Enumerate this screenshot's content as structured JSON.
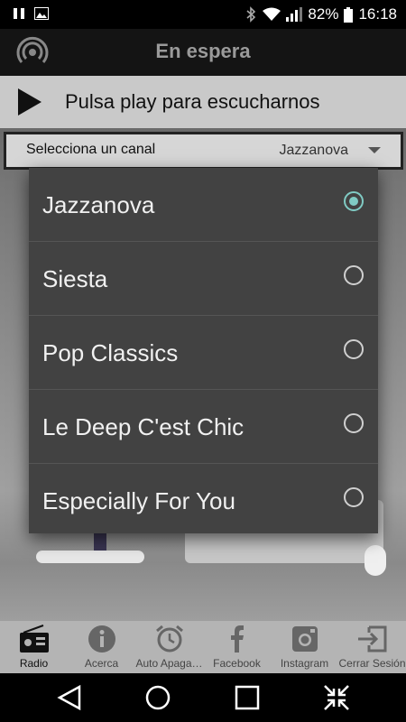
{
  "status_bar": {
    "battery": "82%",
    "time": "16:18",
    "left_icons": [
      "pause-notification-icon",
      "image-notification-icon"
    ],
    "right_icons": [
      "bluetooth-icon",
      "wifi-icon",
      "signal-icon",
      "battery-icon"
    ]
  },
  "header": {
    "title": "En espera",
    "icon": "cast-icon"
  },
  "player": {
    "label": "Pulsa play para escucharnos",
    "icon": "play-icon"
  },
  "channel_selector": {
    "label": "Selecciona un canal",
    "value": "Jazzanova"
  },
  "dialog": {
    "options": [
      {
        "label": "Jazzanova",
        "selected": true
      },
      {
        "label": "Siesta",
        "selected": false
      },
      {
        "label": "Pop Classics",
        "selected": false
      },
      {
        "label": "Le Deep C'est Chic",
        "selected": false
      },
      {
        "label": "Especially For You",
        "selected": false
      }
    ]
  },
  "tabs": [
    {
      "label": "Radio",
      "icon": "radio-icon",
      "active": true
    },
    {
      "label": "Acerca",
      "icon": "info-icon",
      "active": false
    },
    {
      "label": "Auto Apaga…",
      "icon": "alarm-clock-icon",
      "active": false
    },
    {
      "label": "Facebook",
      "icon": "facebook-icon",
      "active": false
    },
    {
      "label": "Instagram",
      "icon": "instagram-icon",
      "active": false
    },
    {
      "label": "Cerrar Sesión",
      "icon": "logout-icon",
      "active": false
    }
  ],
  "nav": [
    "back-icon",
    "home-icon",
    "recents-icon",
    "collapse-icon"
  ],
  "colors": {
    "accent": "#80cbc4",
    "dialog_bg": "#424242",
    "tabbar_bg": "#b4b4b4",
    "appbar_bg": "#141414"
  }
}
